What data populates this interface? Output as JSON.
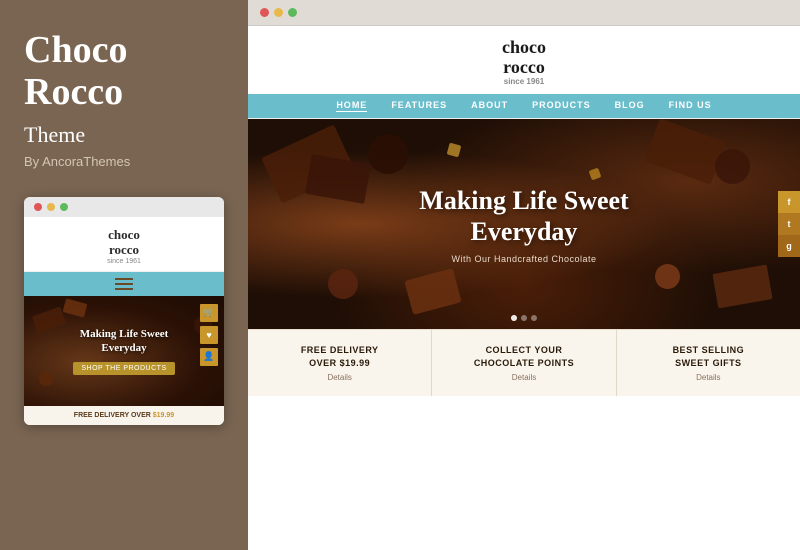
{
  "sidebar": {
    "brand_line1": "Choco",
    "brand_line2": "Rocco",
    "theme_label": "Theme",
    "by_label": "By AncoraThemes"
  },
  "mobile_preview": {
    "dots": [
      "red",
      "yellow",
      "green"
    ],
    "logo_line1": "choco",
    "logo_line2": "rocco",
    "logo_since": "since 1961",
    "hero_title_line1": "Making Life Sweet",
    "hero_title_line2": "Everyday",
    "shop_btn": "SHOP THE PRODUCTS",
    "footer_text": "FREE DELIVERY OVER ",
    "footer_price": "$19.99"
  },
  "browser": {
    "dots": [
      "red",
      "yellow",
      "green"
    ],
    "site_logo_line1": "choco",
    "site_logo_line2": "rocco",
    "site_logo_since": "since 1961",
    "nav_items": [
      {
        "label": "HOME",
        "active": true
      },
      {
        "label": "FEATURES",
        "active": false
      },
      {
        "label": "ABOUT",
        "active": false
      },
      {
        "label": "PRODUCTS",
        "active": false
      },
      {
        "label": "BLOG",
        "active": false
      },
      {
        "label": "FIND US",
        "active": false
      }
    ],
    "hero_title_line1": "Making Life Sweet",
    "hero_title_line2": "Everyday",
    "hero_subtitle": "With Our Handcrafted Chocolate",
    "social_icons": [
      "f",
      "t",
      "g"
    ],
    "features": [
      {
        "title_line1": "FREE DELIVERY",
        "title_line2": "OVER $19.99",
        "details": "Details"
      },
      {
        "title_line1": "COLLECT YOUR",
        "title_line2": "CHOCOLATE POINTS",
        "details": "Details"
      },
      {
        "title_line1": "BEST SELLING",
        "title_line2": "SWEET GIFTS",
        "details": "Details"
      }
    ]
  }
}
